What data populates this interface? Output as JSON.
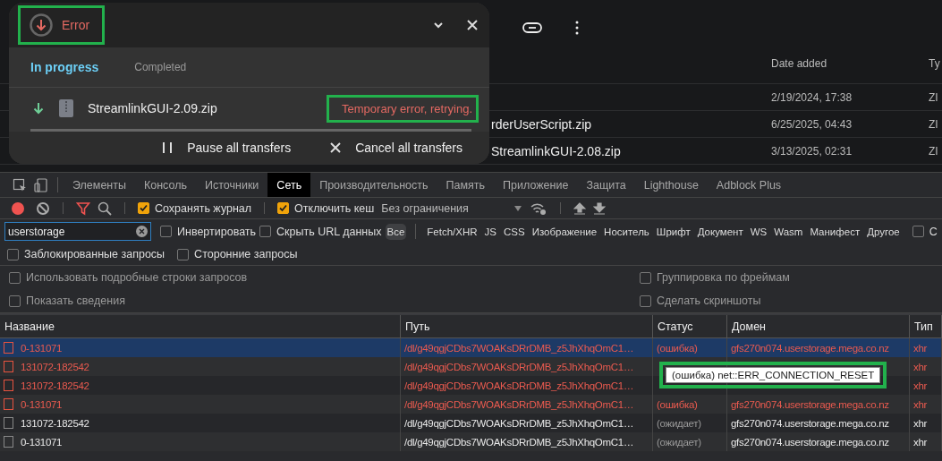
{
  "file_list": {
    "columns": [
      {
        "label": "Date added"
      },
      {
        "label": "Ty"
      }
    ],
    "rows": [
      {
        "date": "2/19/2024, 17:38",
        "type": "ZI"
      },
      {
        "name": "rderUserScript.zip",
        "date": "6/25/2025, 04:43",
        "type": "ZI"
      },
      {
        "name": "StreamlinkGUI-2.08.zip",
        "date": "3/13/2025, 02:31",
        "type": "ZI"
      }
    ]
  },
  "transfers_popup": {
    "status": {
      "label": "Error",
      "highlighted": true
    },
    "tabs": [
      {
        "label": "In progress",
        "selected": true
      },
      {
        "label": "Completed",
        "selected": false
      }
    ],
    "items": [
      {
        "name": "StreamlinkGUI-2.09.zip",
        "status": "Temporary error, retrying.",
        "status_highlighted": true
      }
    ],
    "actions": [
      {
        "kind": "pause",
        "label": "Pause all transfers"
      },
      {
        "kind": "cancel",
        "label": "Cancel all transfers"
      }
    ]
  },
  "devtools": {
    "tabs": [
      {
        "label": "Элементы",
        "selected": false
      },
      {
        "label": "Консоль",
        "selected": false
      },
      {
        "label": "Источники",
        "selected": false
      },
      {
        "label": "Сеть",
        "selected": true
      },
      {
        "label": "Производительность",
        "selected": false
      },
      {
        "label": "Память",
        "selected": false
      },
      {
        "label": "Приложение",
        "selected": false
      },
      {
        "label": "Защита",
        "selected": false
      },
      {
        "label": "Lighthouse",
        "selected": false
      },
      {
        "label": "Adblock Plus",
        "selected": false
      }
    ],
    "toolbar": {
      "recording": true,
      "filter_active": true,
      "checkboxes": [
        {
          "label": "Сохранять журнал",
          "checked": true
        },
        {
          "label": "Отключить кеш",
          "checked": true
        }
      ],
      "throttling": "Без ограничения"
    },
    "filter": {
      "search": "userstorage",
      "checkboxes": [
        {
          "label": "Инвертировать",
          "checked": false
        },
        {
          "label": "Скрыть URL данных",
          "checked": false
        }
      ],
      "types": [
        {
          "label": "Все",
          "selected": true
        },
        {
          "label": "Fetch/XHR",
          "selected": false
        },
        {
          "label": "JS",
          "selected": false
        },
        {
          "label": "CSS",
          "selected": false
        },
        {
          "label": "Изображение",
          "selected": false
        },
        {
          "label": "Носитель",
          "selected": false
        },
        {
          "label": "Шрифт",
          "selected": false
        },
        {
          "label": "Документ",
          "selected": false
        },
        {
          "label": "WS",
          "selected": false
        },
        {
          "label": "Wasm",
          "selected": false
        },
        {
          "label": "Манифест",
          "selected": false
        },
        {
          "label": "Другое",
          "selected": false
        }
      ],
      "extra_checkbox": {
        "label": "С",
        "checked": false
      }
    },
    "options": [
      {
        "label": "Заблокированные запросы",
        "checked": false
      },
      {
        "label": "Сторонние запросы",
        "checked": false
      }
    ],
    "settings_left": [
      {
        "label": "Использовать подробные строки запросов",
        "checked": false
      },
      {
        "label": "Показать сведения",
        "checked": false
      }
    ],
    "settings_right": [
      {
        "label": "Группировка по фреймам",
        "checked": false
      },
      {
        "label": "Сделать скриншоты",
        "checked": false
      }
    ],
    "table": {
      "columns": [
        "Название",
        "Путь",
        "Статус",
        "Домен",
        "Тип"
      ],
      "rows": [
        {
          "name": "0-131071",
          "path": "/dl/g49qgjCDbs7WOAKsDRrDMB_z5JhXhqOmC1…",
          "status": "(ошибка)",
          "domain": "gfs270n074.userstorage.mega.co.nz",
          "type": "xhr",
          "failed": true,
          "selected": true
        },
        {
          "name": "131072-182542",
          "path": "/dl/g49qgjCDbs7WOAKsDRrDMB_z5JhXhqOmC1…",
          "type": "xhr",
          "failed": true,
          "selected": false
        },
        {
          "name": "131072-182542",
          "path": "/dl/g49qgjCDbs7WOAKsDRrDMB_z5JhXhqOmC1…",
          "type": "xhr",
          "failed": true,
          "selected": false
        },
        {
          "name": "0-131071",
          "path": "/dl/g49qgjCDbs7WOAKsDRrDMB_z5JhXhqOmC1…",
          "status": "(ошибка)",
          "domain": "gfs270n074.userstorage.mega.co.nz",
          "type": "xhr",
          "failed": true,
          "selected": false
        },
        {
          "name": "131072-182542",
          "path": "/dl/g49qgjCDbs7WOAKsDRrDMB_z5JhXhqOmC1…",
          "status": "(ожидает)",
          "domain": "gfs270n074.userstorage.mega.co.nz",
          "type": "xhr",
          "failed": false,
          "selected": false
        },
        {
          "name": "0-131071",
          "path": "/dl/g49qgjCDbs7WOAKsDRrDMB_z5JhXhqOmC1…",
          "status": "(ожидает)",
          "domain": "gfs270n074.userstorage.mega.co.nz",
          "type": "xhr",
          "failed": false,
          "selected": false
        }
      ]
    },
    "tooltip": {
      "text": "(ошибка) net::ERR_CONNECTION_RESET",
      "highlighted": true
    }
  }
}
